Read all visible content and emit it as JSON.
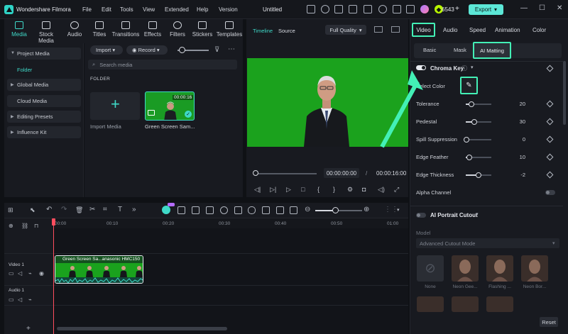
{
  "app": {
    "name": "Wondershare Filmora",
    "doc_title": "Untitled",
    "credits": "6543",
    "export_label": "Export"
  },
  "menu": [
    "File",
    "Edit",
    "Tools",
    "View",
    "Extended",
    "Help",
    "Version"
  ],
  "left_tabs": [
    "Media",
    "Stock Media",
    "Audio",
    "Titles",
    "Transitions",
    "Effects",
    "Filters",
    "Stickers",
    "Templates"
  ],
  "left_nav": {
    "project_media": "Project Media",
    "folder": "Folder",
    "global_media": "Global Media",
    "cloud_media": "Cloud Media",
    "editing_presets": "Editing Presets",
    "influence_kit": "Influence Kit"
  },
  "media": {
    "import_label": "Import",
    "record_label": "Record",
    "search_placeholder": "Search media",
    "folder_heading": "FOLDER",
    "import_tile_label": "Import Media",
    "clip_name": "Green Screen Sam...",
    "clip_duration": "00:00:16"
  },
  "preview": {
    "tab_timeline": "Timeline",
    "tab_source": "Source",
    "quality": "Full Quality",
    "current_time": "00:00:00:00",
    "total_time": "00:00:16:00"
  },
  "right_tabs": [
    "Video",
    "Audio",
    "Speed",
    "Animation",
    "Color"
  ],
  "sub_tabs": [
    "Basic",
    "Mask",
    "AI Matting"
  ],
  "chroma": {
    "title": "Chroma Key",
    "select_color": "Select Color",
    "params": [
      {
        "label": "Tolerance",
        "value": "20",
        "fraction": 0.2
      },
      {
        "label": "Pedestal",
        "value": "30",
        "fraction": 0.3
      },
      {
        "label": "Spill Suppression",
        "value": "0",
        "fraction": 0.0
      },
      {
        "label": "Edge Feather",
        "value": "10",
        "fraction": 0.1
      },
      {
        "label": "Edge Thickness",
        "value": "-2",
        "fraction": 0.48
      }
    ],
    "alpha_channel": "Alpha Channel"
  },
  "portrait": {
    "title": "AI Portrait Cutout",
    "model_label": "Model",
    "model_value": "Advanced Cutout Mode",
    "options": [
      "None",
      "Neon Gee...",
      "Flashing ...",
      "Neon Bor..."
    ]
  },
  "reset_label": "Reset",
  "timeline": {
    "ticks": [
      "00:00",
      "00:00:00:10",
      "00:20",
      "00:30",
      "00:40",
      "00:50",
      "01:00"
    ],
    "tick_labels": [
      "00:00",
      "00:10",
      "00:20",
      "00:30",
      "00:40",
      "00:50",
      "01:00"
    ],
    "video_track": "Video 1",
    "audio_track": "Audio 1",
    "clip_title": "Green Screen Sa...anasonic HMC150"
  },
  "colors": {
    "accent": "#3fd9c8",
    "highlight": "#43f0b6",
    "playhead": "#ff4d5e",
    "green_screen": "#1ba21d"
  }
}
